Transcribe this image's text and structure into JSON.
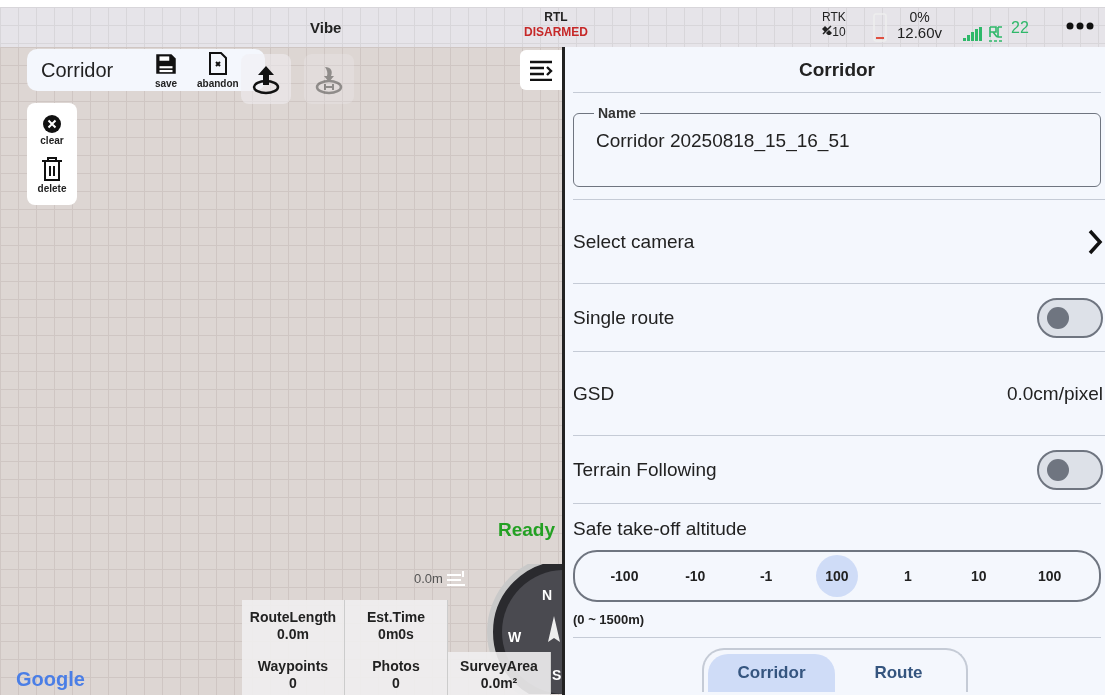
{
  "status_bar": {
    "vehicle": "Vibe",
    "mode": "RTL",
    "arm_state": "DISARMED",
    "gps_label": "RTK",
    "satellites": "10",
    "battery_percent": "0%",
    "voltage": "12.60v",
    "rc_count": "22"
  },
  "mission_toolbar": {
    "title": "Corridor",
    "actions": [
      {
        "kind": "save",
        "label": "save"
      },
      {
        "kind": "abandon",
        "label": "abandon"
      }
    ]
  },
  "map_buttons": [
    {
      "kind": "upload",
      "disabled": false
    },
    {
      "kind": "home",
      "disabled": true
    }
  ],
  "edit_tools": [
    {
      "kind": "clear",
      "label": "clear"
    },
    {
      "kind": "delete",
      "label": "delete"
    }
  ],
  "status_text": "Ready",
  "altitude_reading": "0.0m",
  "stats": [
    {
      "label": "RouteLength",
      "value": "0.0m"
    },
    {
      "label": "Est.Time",
      "value": "0m0s"
    },
    {
      "label": "Waypoints",
      "value": "0"
    },
    {
      "label": "Photos",
      "value": "0"
    },
    {
      "label": "SurveyArea",
      "value": "0.0m²"
    }
  ],
  "compass_labels": [
    "N",
    "W",
    "S"
  ],
  "map_attribution": "Google",
  "panel": {
    "title": "Corridor",
    "name_field": {
      "label": "Name",
      "value": "Corridor 20250818_15_16_51"
    },
    "rows": [
      {
        "kind": "link",
        "label": "Select camera"
      },
      {
        "kind": "toggle",
        "label": "Single route",
        "on": false
      },
      {
        "kind": "value",
        "label": "GSD",
        "value": "0.0cm/pixel"
      },
      {
        "kind": "toggle",
        "label": "Terrain Following",
        "on": false
      }
    ],
    "altitude": {
      "label": "Safe take-off altitude",
      "steps": [
        {
          "label": "-100",
          "selected": false
        },
        {
          "label": "-10",
          "selected": false
        },
        {
          "label": "-1",
          "selected": false
        },
        {
          "label": "100",
          "selected": true
        },
        {
          "label": "1",
          "selected": false
        },
        {
          "label": "10",
          "selected": false
        },
        {
          "label": "100",
          "selected": false
        }
      ],
      "range": "(0 ~ 1500m)"
    },
    "mode_tabs": [
      {
        "label": "Corridor",
        "selected": true
      },
      {
        "label": "Route",
        "selected": false
      }
    ]
  }
}
